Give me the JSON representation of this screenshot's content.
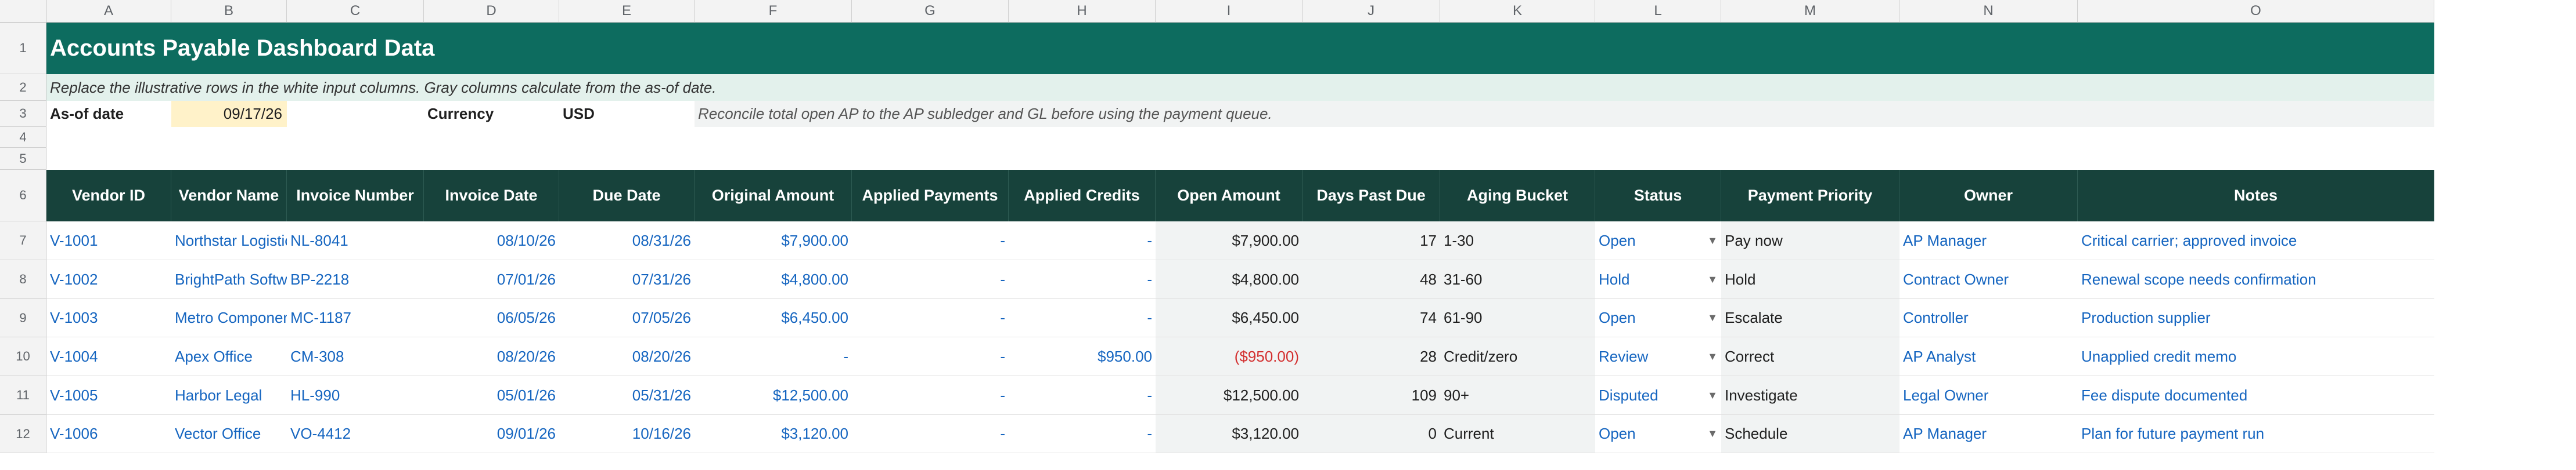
{
  "column_letters": [
    "A",
    "B",
    "C",
    "D",
    "E",
    "F",
    "G",
    "H",
    "I",
    "J",
    "K",
    "L",
    "M",
    "N",
    "O"
  ],
  "row_numbers": [
    "1",
    "2",
    "3",
    "4",
    "5",
    "6",
    "7",
    "8",
    "9",
    "10",
    "11",
    "12"
  ],
  "title": "Accounts Payable Dashboard Data",
  "subtitle": "Replace the illustrative rows in the white input columns. Gray columns calculate from the as-of date.",
  "as_of_label": "As-of date",
  "as_of_value": "09/17/26",
  "currency_label": "Currency",
  "currency_value": "USD",
  "reconcile_note": "Reconcile total open AP to the AP subledger and GL before using the payment queue.",
  "headers": [
    "Vendor ID",
    "Vendor Name",
    "Invoice Number",
    "Invoice Date",
    "Due Date",
    "Original Amount",
    "Applied Payments",
    "Applied Credits",
    "Open Amount",
    "Days Past Due",
    "Aging Bucket",
    "Status",
    "Payment Priority",
    "Owner",
    "Notes"
  ],
  "rows": [
    {
      "vendor_id": "V-1001",
      "vendor_name": "Northstar Logistics",
      "invoice_number": "NL-8041",
      "invoice_date": "08/10/26",
      "due_date": "08/31/26",
      "original_amount": "$7,900.00",
      "applied_payments": "-",
      "applied_credits": "-",
      "open_amount": "$7,900.00",
      "days_past_due": "17",
      "aging_bucket": "1-30",
      "status": "Open",
      "payment_priority": "Pay now",
      "owner": "AP Manager",
      "notes": "Critical carrier; approved invoice"
    },
    {
      "vendor_id": "V-1002",
      "vendor_name": "BrightPath Software",
      "invoice_number": "BP-2218",
      "invoice_date": "07/01/26",
      "due_date": "07/31/26",
      "original_amount": "$4,800.00",
      "applied_payments": "-",
      "applied_credits": "-",
      "open_amount": "$4,800.00",
      "days_past_due": "48",
      "aging_bucket": "31-60",
      "status": "Hold",
      "payment_priority": "Hold",
      "owner": "Contract Owner",
      "notes": "Renewal scope needs confirmation"
    },
    {
      "vendor_id": "V-1003",
      "vendor_name": "Metro Components",
      "invoice_number": "MC-1187",
      "invoice_date": "06/05/26",
      "due_date": "07/05/26",
      "original_amount": "$6,450.00",
      "applied_payments": "-",
      "applied_credits": "-",
      "open_amount": "$6,450.00",
      "days_past_due": "74",
      "aging_bucket": "61-90",
      "status": "Open",
      "payment_priority": "Escalate",
      "owner": "Controller",
      "notes": "Production supplier"
    },
    {
      "vendor_id": "V-1004",
      "vendor_name": "Apex Office",
      "invoice_number": "CM-308",
      "invoice_date": "08/20/26",
      "due_date": "08/20/26",
      "original_amount": "-",
      "applied_payments": "-",
      "applied_credits": "$950.00",
      "open_amount": "($950.00)",
      "days_past_due": "28",
      "aging_bucket": "Credit/zero",
      "status": "Review",
      "payment_priority": "Correct",
      "owner": "AP Analyst",
      "notes": "Unapplied credit memo"
    },
    {
      "vendor_id": "V-1005",
      "vendor_name": "Harbor Legal",
      "invoice_number": "HL-990",
      "invoice_date": "05/01/26",
      "due_date": "05/31/26",
      "original_amount": "$12,500.00",
      "applied_payments": "-",
      "applied_credits": "-",
      "open_amount": "$12,500.00",
      "days_past_due": "109",
      "aging_bucket": "90+",
      "status": "Disputed",
      "payment_priority": "Investigate",
      "owner": "Legal Owner",
      "notes": "Fee dispute documented"
    },
    {
      "vendor_id": "V-1006",
      "vendor_name": "Vector Office",
      "invoice_number": "VO-4412",
      "invoice_date": "09/01/26",
      "due_date": "10/16/26",
      "original_amount": "$3,120.00",
      "applied_payments": "-",
      "applied_credits": "-",
      "open_amount": "$3,120.00",
      "days_past_due": "0",
      "aging_bucket": "Current",
      "status": "Open",
      "payment_priority": "Schedule",
      "owner": "AP Manager",
      "notes": "Plan for future payment run"
    }
  ],
  "icons": {
    "status_dropdown": "triangle-down-icon"
  },
  "colors": {
    "title_bg": "#0d6c5f",
    "header_bg": "#17423b",
    "input_text": "#1565c0",
    "negative": "#d32f2f",
    "as_of_fill": "#fff2c9"
  }
}
